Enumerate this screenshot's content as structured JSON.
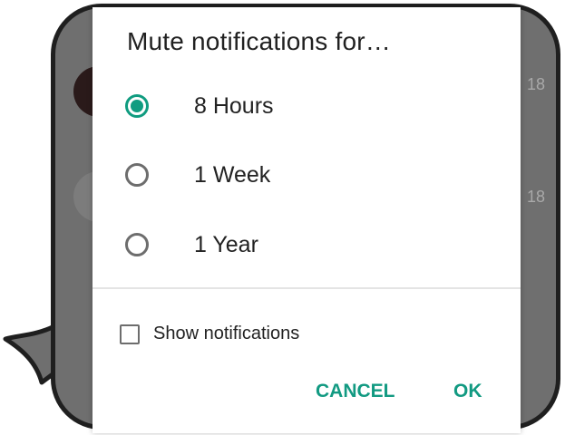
{
  "dialog": {
    "title": "Mute notifications for…",
    "options": [
      {
        "label": "8 Hours",
        "selected": true
      },
      {
        "label": "1 Week",
        "selected": false
      },
      {
        "label": "1 Year",
        "selected": false
      }
    ],
    "show_notifications_label": "Show notifications",
    "show_notifications_checked": false,
    "cancel_label": "CANCEL",
    "ok_label": "OK"
  },
  "background": {
    "times": [
      "18",
      "18"
    ]
  },
  "colors": {
    "accent": "#109c80",
    "frame": "#1f1f1f",
    "dim_overlay": "#6f6f6f"
  }
}
